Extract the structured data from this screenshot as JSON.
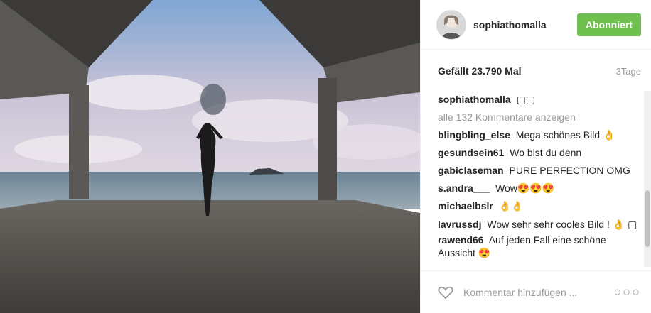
{
  "post": {
    "username": "sophiathomalla",
    "follow_label": "Abonniert",
    "likes_text": "Gefällt 23.790 Mal",
    "time_text": "3Tage"
  },
  "comments": {
    "caption": {
      "user": "sophiathomalla",
      "text": "▢▢"
    },
    "view_all": "alle 132 Kommentare anzeigen",
    "items": [
      {
        "user": "blingbling_else",
        "text": "Mega schönes Bild 👌"
      },
      {
        "user": "gesundsein61",
        "text": "Wo bist du denn"
      },
      {
        "user": "gabiclaseman",
        "text": "PURE PERFECTION OMG"
      },
      {
        "user": "s.andra___",
        "text": "Wow😍😍😍"
      },
      {
        "user": "michaelbslr",
        "text": "👌👌"
      },
      {
        "user": "lavrussdj",
        "text": "Wow sehr sehr cooles Bild ! 👌 ▢"
      },
      {
        "user": "rawend66",
        "text": "Auf jeden Fall eine schöne Aussicht 😍"
      }
    ]
  },
  "add_comment": {
    "placeholder": "Kommentar hinzufügen ...",
    "more_icon": "more-options-icon"
  }
}
